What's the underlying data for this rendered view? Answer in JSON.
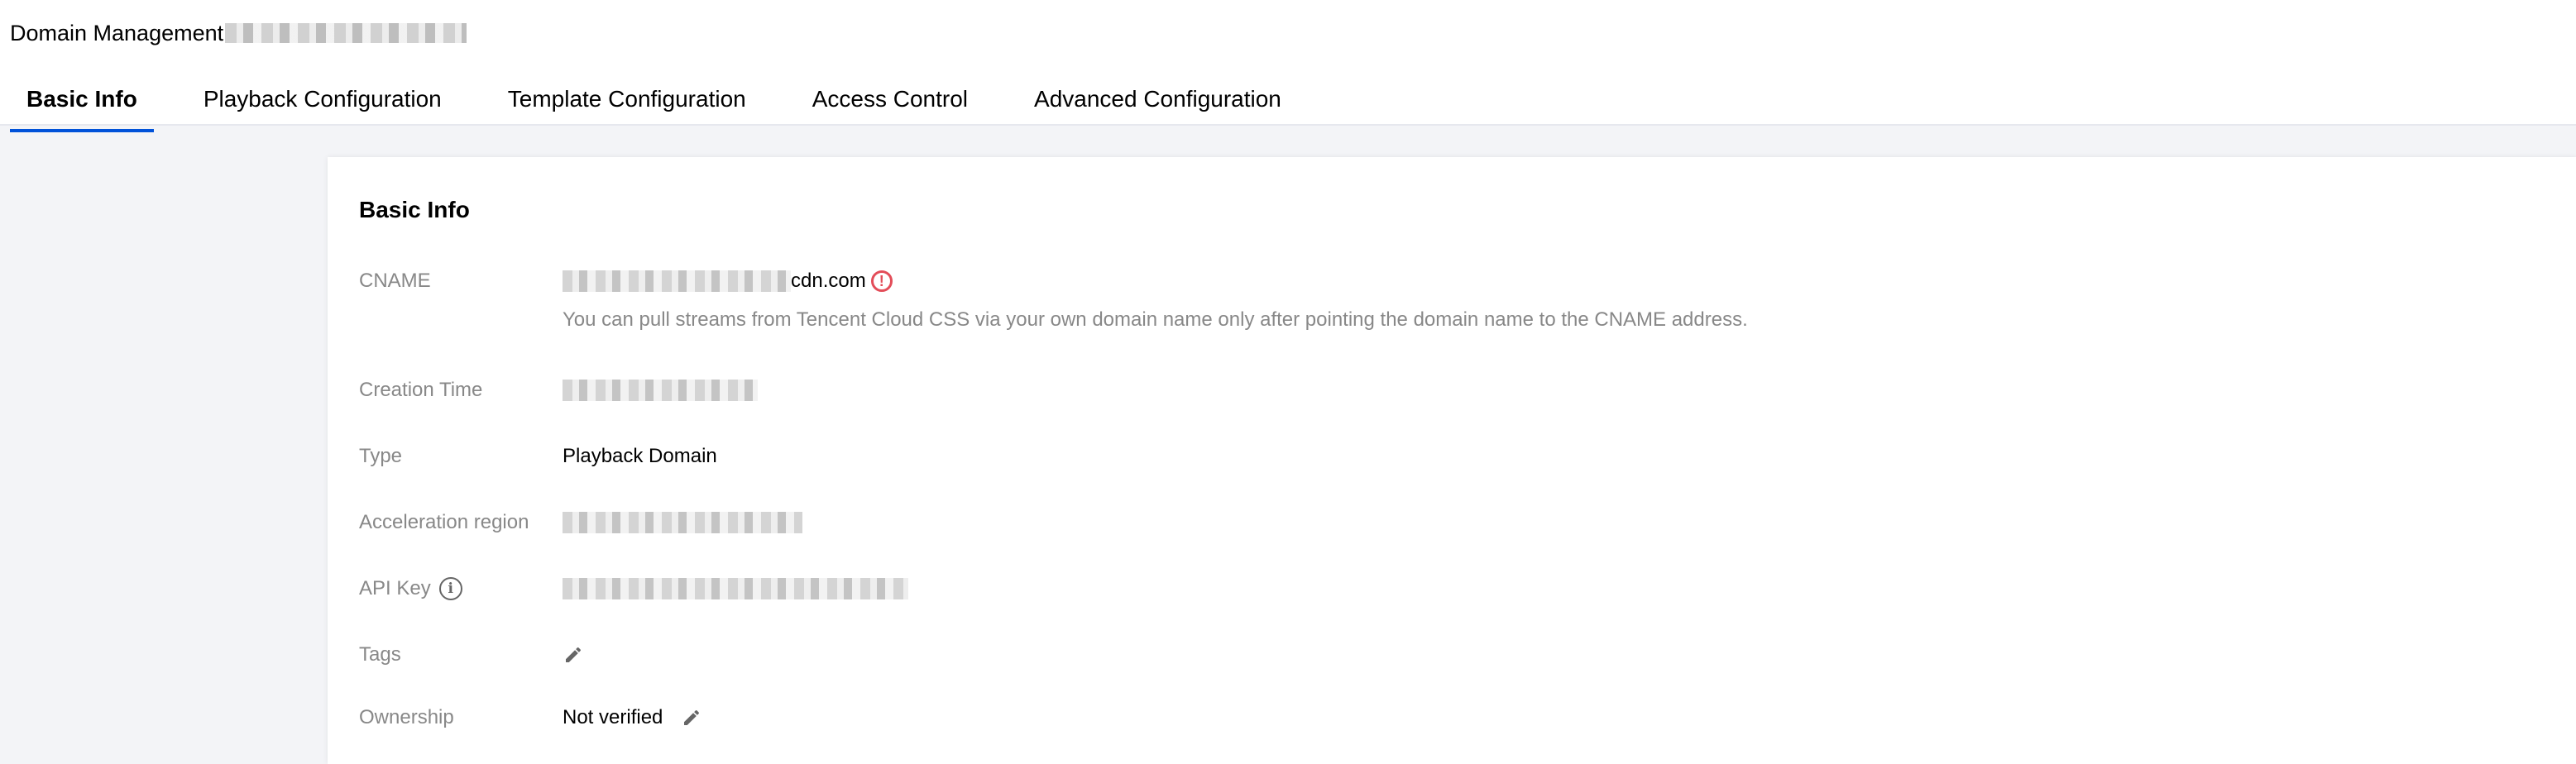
{
  "header": {
    "title": "Domain Management"
  },
  "tabs": [
    {
      "label": "Basic Info",
      "active": true
    },
    {
      "label": "Playback Configuration",
      "active": false
    },
    {
      "label": "Template Configuration",
      "active": false
    },
    {
      "label": "Access Control",
      "active": false
    },
    {
      "label": "Advanced Configuration",
      "active": false
    }
  ],
  "card": {
    "title": "Basic Info",
    "cname": {
      "label": "CNAME",
      "value_suffix": "cdn.com",
      "hint": "You can pull streams from Tencent Cloud CSS via your own domain name only after pointing the domain name to the CNAME address."
    },
    "creation_time": {
      "label": "Creation Time"
    },
    "type": {
      "label": "Type",
      "value": "Playback Domain"
    },
    "acceleration_region": {
      "label": "Acceleration region"
    },
    "api_key": {
      "label": "API Key"
    },
    "tags": {
      "label": "Tags"
    },
    "ownership": {
      "label": "Ownership",
      "value": "Not verified"
    }
  },
  "icons": {
    "alert": "exclamation-circle-icon",
    "info": "info-circle-icon",
    "edit": "pencil-icon"
  },
  "colors": {
    "accent": "#0052d9",
    "alert": "#e34d59",
    "label": "#888888",
    "background": "#f3f4f7"
  }
}
